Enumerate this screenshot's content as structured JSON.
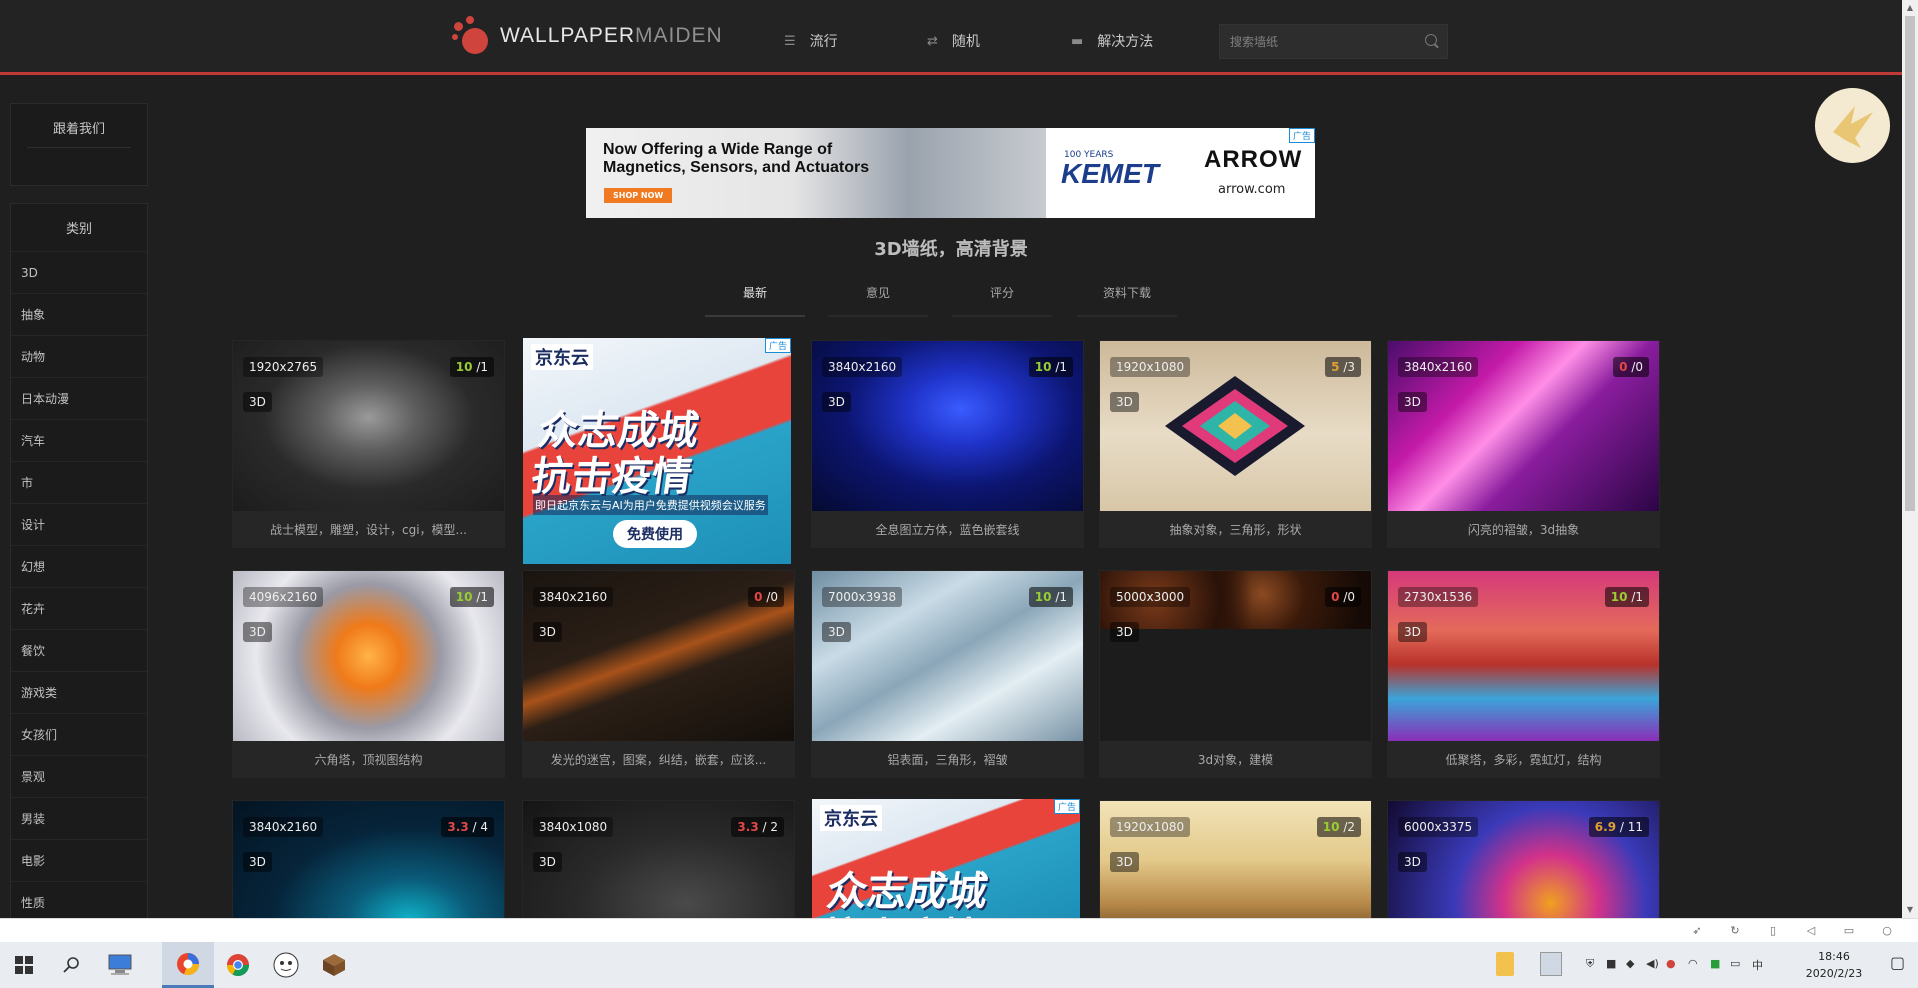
{
  "header": {
    "logo_part1": "WALLPAPER",
    "logo_part2": "MAIDEN",
    "nav": [
      {
        "icon": "menu-icon",
        "label": "流行"
      },
      {
        "icon": "shuffle-icon",
        "label": "随机"
      },
      {
        "icon": "folder-icon",
        "label": "解决方法"
      }
    ],
    "search_placeholder": "搜索墙纸"
  },
  "sidebar": {
    "follow_title": "跟着我们",
    "categories_title": "类别",
    "categories": [
      "3D",
      "抽象",
      "动物",
      "日本动漫",
      "汽车",
      "市",
      "设计",
      "幻想",
      "花卉",
      "餐饮",
      "游戏类",
      "女孩们",
      "景观",
      "男装",
      "电影",
      "性质"
    ]
  },
  "top_ad": {
    "headline": "Now Offering a Wide Range of Magnetics, Sensors, and Actuators",
    "cta": "SHOP NOW",
    "brand1": "KEMET",
    "brand1_year": "100 YEARS",
    "brand2": "ARROW",
    "url": "arrow.com",
    "ad_label": "广告"
  },
  "page_title": "3D墙纸，高清背景",
  "tabs": [
    "最新",
    "意见",
    "评分",
    "资料下载"
  ],
  "jd_ad": {
    "logo": "京东云",
    "headline_line1": "众志成城",
    "headline_line2": "抗击疫情",
    "sub": "即日起京东云与AI为用户免费提供视频会议服务",
    "button": "免费使用",
    "ad_label": "广告"
  },
  "wallpapers": [
    {
      "res": "1920x2765",
      "tag": "3D",
      "score": "10",
      "votes": "1",
      "score_color": "#9acd32",
      "caption": "战士模型，雕塑，设计，cgi，模型..."
    },
    {
      "res": "3840x2160",
      "tag": "3D",
      "score": "10",
      "votes": "1",
      "score_color": "#9acd32",
      "caption": "全息图立方体，蓝色嵌套线"
    },
    {
      "res": "1920x1080",
      "tag": "3D",
      "score": "5",
      "votes": "3",
      "score_color": "#e0a030",
      "caption": "抽象对象，三角形，形状"
    },
    {
      "res": "3840x2160",
      "tag": "3D",
      "score": "0",
      "votes": "0",
      "score_color": "#e04848",
      "caption": "闪亮的褶皱，3d抽象"
    },
    {
      "res": "4096x2160",
      "tag": "3D",
      "score": "10",
      "votes": "1",
      "score_color": "#9acd32",
      "caption": "六角塔，顶视图结构"
    },
    {
      "res": "3840x2160",
      "tag": "3D",
      "score": "0",
      "votes": "0",
      "score_color": "#e04848",
      "caption": "发光的迷宫，图案，纠结，嵌套，应该..."
    },
    {
      "res": "7000x3938",
      "tag": "3D",
      "score": "10",
      "votes": "1",
      "score_color": "#9acd32",
      "caption": "铝表面，三角形，褶皱"
    },
    {
      "res": "5000x3000",
      "tag": "3D",
      "score": "0",
      "votes": "0",
      "score_color": "#e04848",
      "caption": "3d对象，建模"
    },
    {
      "res": "2730x1536",
      "tag": "3D",
      "score": "10",
      "votes": "1",
      "score_color": "#9acd32",
      "caption": "低聚塔，多彩，霓虹灯，结构"
    },
    {
      "res": "3840x2160",
      "tag": "3D",
      "score": "3.3",
      "votes": "4",
      "score_color": "#e04848",
      "caption": ""
    },
    {
      "res": "3840x1080",
      "tag": "3D",
      "score": "3.3",
      "votes": "2",
      "score_color": "#e04848",
      "caption": ""
    },
    {
      "res": "1920x1080",
      "tag": "3D",
      "score": "10",
      "votes": "2",
      "score_color": "#9acd32",
      "caption": ""
    },
    {
      "res": "6000x3375",
      "tag": "3D",
      "score": "6.9",
      "votes": "11",
      "score_color": "#e0a030",
      "caption": ""
    }
  ],
  "taskbar": {
    "tray_ime": "中",
    "time": "18:46",
    "date": "2020/2/23"
  }
}
